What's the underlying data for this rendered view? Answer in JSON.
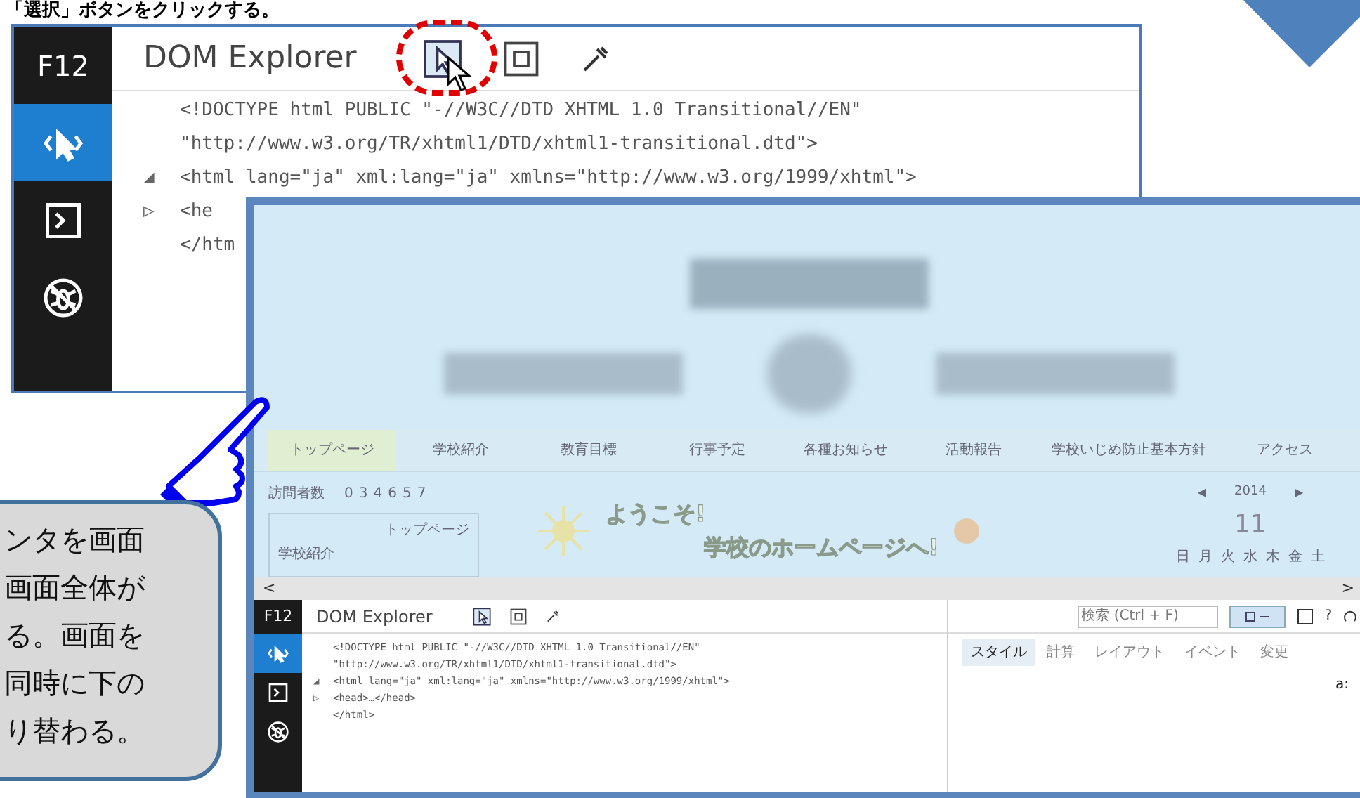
{
  "caption": "「選択」ボタンをクリックする。",
  "devtools_top": {
    "f12": "F12",
    "title": "DOM Explorer",
    "sidebar": [
      {
        "kind": "select",
        "selected": true
      },
      {
        "kind": "console",
        "selected": false
      },
      {
        "kind": "debugger",
        "selected": false
      }
    ],
    "code_lines": [
      {
        "text": "<!DOCTYPE html PUBLIC \"-//W3C//DTD XHTML 1.0 Transitional//EN\""
      },
      {
        "text": "\"http://www.w3.org/TR/xhtml1/DTD/xhtml1-transitional.dtd\">"
      },
      {
        "marker": "◢",
        "text": "<html lang=\"ja\" xml:lang=\"ja\" xmlns=\"http://www.w3.org/1999/xhtml\">"
      },
      {
        "marker": "▷",
        "text": "<he"
      },
      {
        "text": "</htm"
      }
    ]
  },
  "browser": {
    "nav": [
      {
        "label": "トップページ",
        "selected": true
      },
      {
        "label": "学校紹介",
        "selected": false
      },
      {
        "label": "教育目標",
        "selected": false
      },
      {
        "label": "行事予定",
        "selected": false
      },
      {
        "label": "各種お知らせ",
        "selected": false
      },
      {
        "label": "活動報告",
        "selected": false
      },
      {
        "label": "学校いじめ防止基本方針",
        "selected": false
      },
      {
        "label": "アクセス",
        "selected": false
      }
    ],
    "counter_label": "訪問者数",
    "counter_digits": [
      "0",
      "3",
      "4",
      "6",
      "5",
      "7"
    ],
    "side_menu_title": "トップページ",
    "side_menu_items": [
      "学校紹介"
    ],
    "welcome_line_1": "ようこそ!",
    "welcome_line_2": "学校のホームページへ!",
    "calendar": {
      "prev": "◀",
      "year": "2014",
      "next": "▶",
      "month": "11",
      "weekdays": [
        "日",
        "月",
        "火",
        "水",
        "木",
        "金",
        "土"
      ]
    },
    "scroll_left": "<",
    "scroll_right": ">"
  },
  "devtools_bottom": {
    "f12": "F12",
    "title": "DOM Explorer",
    "sidebar": [
      {
        "kind": "select",
        "selected": true
      },
      {
        "kind": "console",
        "selected": false
      },
      {
        "kind": "debugger",
        "selected": false
      }
    ],
    "code_lines": [
      {
        "text": "<!DOCTYPE html PUBLIC \"-//W3C//DTD XHTML 1.0 Transitional//EN\""
      },
      {
        "text": "\"http://www.w3.org/TR/xhtml1/DTD/xhtml1-transitional.dtd\">"
      },
      {
        "marker": "◢",
        "text": "<html lang=\"ja\" xml:lang=\"ja\" xmlns=\"http://www.w3.org/1999/xhtml\">"
      },
      {
        "marker": "▷",
        "text": "<head>…</head>"
      },
      {
        "text": "</html>"
      }
    ],
    "search": {
      "placeholder": "検索 (Ctrl + F)"
    },
    "help": "?",
    "tabs": [
      {
        "label": "スタイル",
        "selected": true
      },
      {
        "label": "計算",
        "selected": false
      },
      {
        "label": "レイアウト",
        "selected": false
      },
      {
        "label": "イベント",
        "selected": false
      },
      {
        "label": "変更",
        "selected": false
      }
    ],
    "style_text": "a:"
  },
  "callout": [
    "ンタを画面",
    "画面全体が",
    "る。画面を",
    "同時に下の",
    "り替わる。"
  ]
}
